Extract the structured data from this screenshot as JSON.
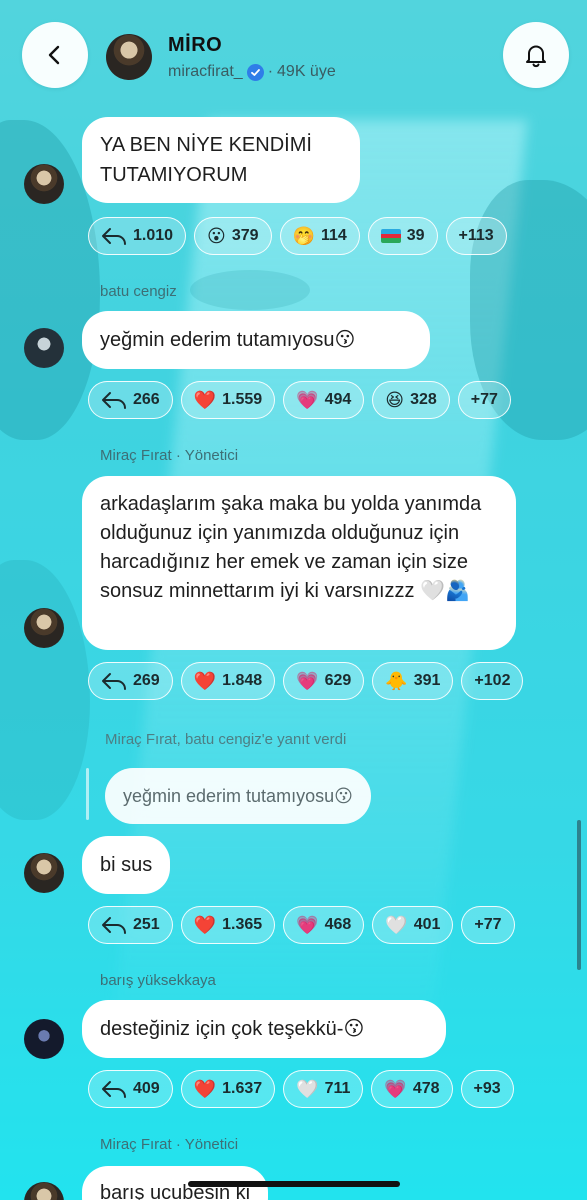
{
  "header": {
    "title": "MİRO",
    "username": "miracfirat_",
    "separator": "·",
    "members": "49K üye"
  },
  "messages": [
    {
      "sender": "",
      "text": "YA BEN NİYE KENDİMİ TUTAMIYORUM",
      "reactions": {
        "replies": "1.010",
        "r1": {
          "emoji": "😮",
          "count": "379"
        },
        "r2": {
          "emoji": "🤭",
          "count": "114"
        },
        "r3": {
          "emoji": "flag-azerbaijan",
          "count": "39"
        },
        "more": "+113"
      }
    },
    {
      "sender": "batu cengiz",
      "text": "yeğmin ederim tutamıyosu😗",
      "reactions": {
        "replies": "266",
        "r1": {
          "emoji": "❤️",
          "count": "1.559"
        },
        "r2": {
          "emoji": "💗",
          "count": "494"
        },
        "r3": {
          "emoji": "😆",
          "count": "328"
        },
        "more": "+77"
      }
    },
    {
      "sender": "Miraç Fırat",
      "role": "· Yönetici",
      "text": "arkadaşlarım şaka maka bu yolda yanımda olduğunuz için yanımızda olduğunuz için harcadığınız her emek ve zaman için size sonsuz minnettarım iyi ki varsınızzz 🤍🫂",
      "reactions": {
        "replies": "269",
        "r1": {
          "emoji": "❤️",
          "count": "1.848"
        },
        "r2": {
          "emoji": "💗",
          "count": "629"
        },
        "r3": {
          "emoji": "🐥",
          "count": "391"
        },
        "more": "+102"
      }
    },
    {
      "reply_note": "Miraç Fırat, batu cengiz'e yanıt verdi",
      "quoted": "yeğmin ederim tutamıyosu😗",
      "text": "bi sus",
      "reactions": {
        "replies": "251",
        "r1": {
          "emoji": "❤️",
          "count": "1.365"
        },
        "r2": {
          "emoji": "💗",
          "count": "468"
        },
        "r3": {
          "emoji": "🤍",
          "count": "401"
        },
        "more": "+77"
      }
    },
    {
      "sender": "barış yüksekkaya",
      "text": "desteğiniz için çok teşekkü-😗",
      "reactions": {
        "replies": "409",
        "r1": {
          "emoji": "❤️",
          "count": "1.637"
        },
        "r2": {
          "emoji": "🤍",
          "count": "711"
        },
        "r3": {
          "emoji": "💗",
          "count": "478"
        },
        "more": "+93"
      }
    },
    {
      "sender": "Miraç Fırat",
      "role": "· Yönetici",
      "text": "barış ucubesin ki"
    }
  ],
  "colors": {
    "background": "#36d8e6",
    "verified": "#2f7ee8",
    "bubble": "#ffffff"
  },
  "icons": [
    "back-arrow-icon",
    "bell-icon",
    "verified-icon",
    "reply-icon"
  ]
}
